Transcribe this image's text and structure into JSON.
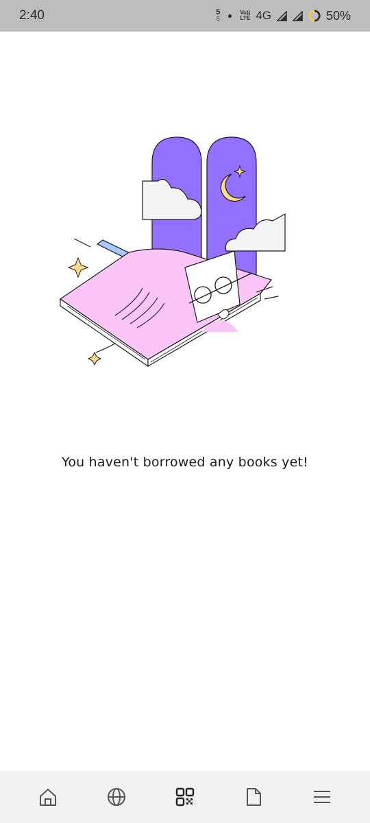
{
  "status_bar": {
    "time": "2:40",
    "sim_slot": "5",
    "sim_slot_sub": "S",
    "volte_top": "Vo))",
    "volte_bottom": "LTE",
    "network": "4G",
    "battery": "50%"
  },
  "empty_state": {
    "message": "You haven't borrowed any books yet!",
    "illustration": "book-with-window-night-icon"
  },
  "bottom_nav": {
    "items": [
      {
        "icon": "home-icon"
      },
      {
        "icon": "globe-icon"
      },
      {
        "icon": "qr-code-icon"
      },
      {
        "icon": "document-icon"
      },
      {
        "icon": "menu-icon"
      }
    ]
  },
  "colors": {
    "status_bar_bg": "#bdbdbd",
    "window_purple": "#9370ff",
    "book_pink": "#fbc6f7",
    "moon_yellow": "#ffd98f",
    "bookmark_blue": "#a8c8ff",
    "nav_bg": "#f1f1f1"
  }
}
